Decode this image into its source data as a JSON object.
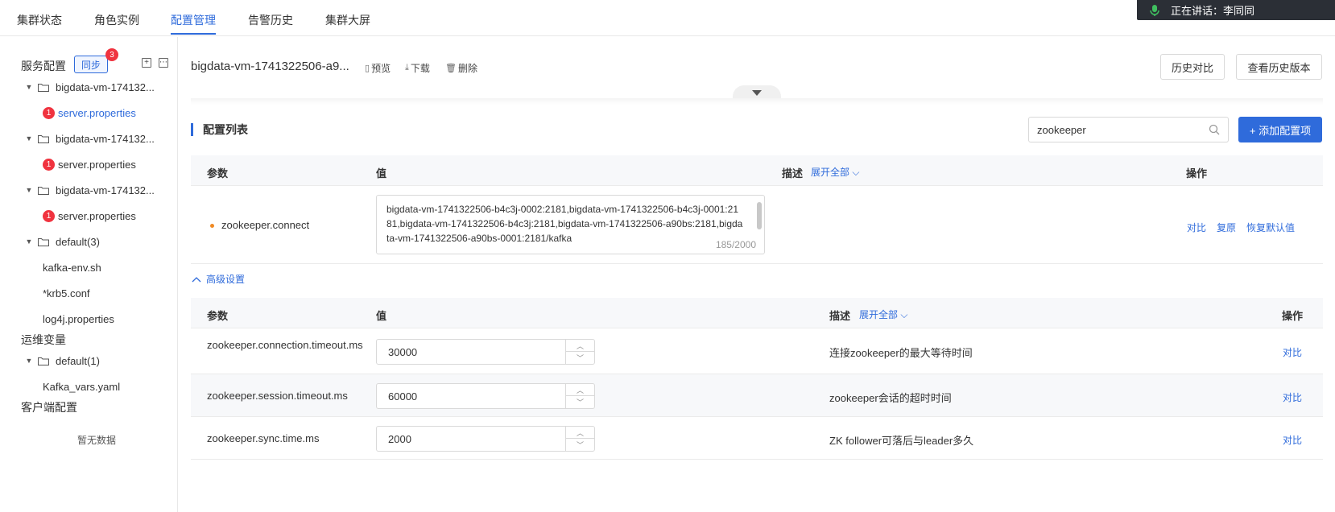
{
  "topnav": {
    "tabs": [
      {
        "label": "集群状态"
      },
      {
        "label": "角色实例"
      },
      {
        "label": "配置管理"
      },
      {
        "label": "告警历史"
      },
      {
        "label": "集群大屏"
      }
    ],
    "speaking": "正在讲话：李同同"
  },
  "sidebar": {
    "service_config": "服务配置",
    "sync_label": "同步",
    "sync_badge": "3",
    "tree": [
      {
        "label": "bigdata-vm-174132..."
      },
      {
        "label": "server.properties",
        "badge": "1"
      },
      {
        "label": "bigdata-vm-174132..."
      },
      {
        "label": "server.properties",
        "badge": "1"
      },
      {
        "label": "bigdata-vm-174132..."
      },
      {
        "label": "server.properties",
        "badge": "1"
      },
      {
        "label": "default(3)"
      },
      {
        "label": "kafka-env.sh"
      },
      {
        "label": "*krb5.conf"
      },
      {
        "label": "log4j.properties"
      }
    ],
    "ops_vars": "运维变量",
    "ops_tree": [
      {
        "label": "default(1)"
      },
      {
        "label": "Kafka_vars.yaml"
      }
    ],
    "client_config": "客户端配置",
    "no_data": "暂无数据"
  },
  "main": {
    "title": "bigdata-vm-1741322506-a9...",
    "actions": {
      "preview": "预览",
      "download": "下载",
      "delete": "删除"
    },
    "history_compare": "历史对比",
    "view_history": "查看历史版本",
    "section_title": "配置列表",
    "search_value": "zookeeper",
    "add_config": "+ 添加配置项",
    "table": {
      "headers": {
        "param": "参数",
        "value": "值",
        "desc": "描述",
        "expand_all": "展开全部",
        "ops": "操作"
      },
      "row": {
        "param": "zookeeper.connect",
        "value": "bigdata-vm-1741322506-b4c3j-0002:2181,bigdata-vm-1741322506-b4c3j-0001:2181,bigdata-vm-1741322506-b4c3j:2181,bigdata-vm-1741322506-a90bs:2181,bigdata-vm-1741322506-a90bs-0001:2181/kafka",
        "count": "185/2000",
        "ops": {
          "compare": "对比",
          "restore": "复原",
          "reset_default": "恢复默认值"
        }
      }
    },
    "advanced": {
      "label": "高级设置",
      "headers": {
        "param": "参数",
        "value": "值",
        "desc": "描述",
        "expand_all": "展开全部",
        "ops": "操作"
      },
      "rows": [
        {
          "param": "zookeeper.connection.timeout.ms",
          "value": "30000",
          "desc": "连接zookeeper的最大等待时间",
          "op": "对比"
        },
        {
          "param": "zookeeper.session.timeout.ms",
          "value": "60000",
          "desc": "zookeeper会话的超时时间",
          "op": "对比"
        },
        {
          "param": "zookeeper.sync.time.ms",
          "value": "2000",
          "desc": "ZK follower可落后与leader多久",
          "op": "对比"
        }
      ]
    }
  },
  "colors": {
    "accent": "#2f6bdb",
    "error": "#f0333f",
    "modified_dot": "#f08a24"
  }
}
